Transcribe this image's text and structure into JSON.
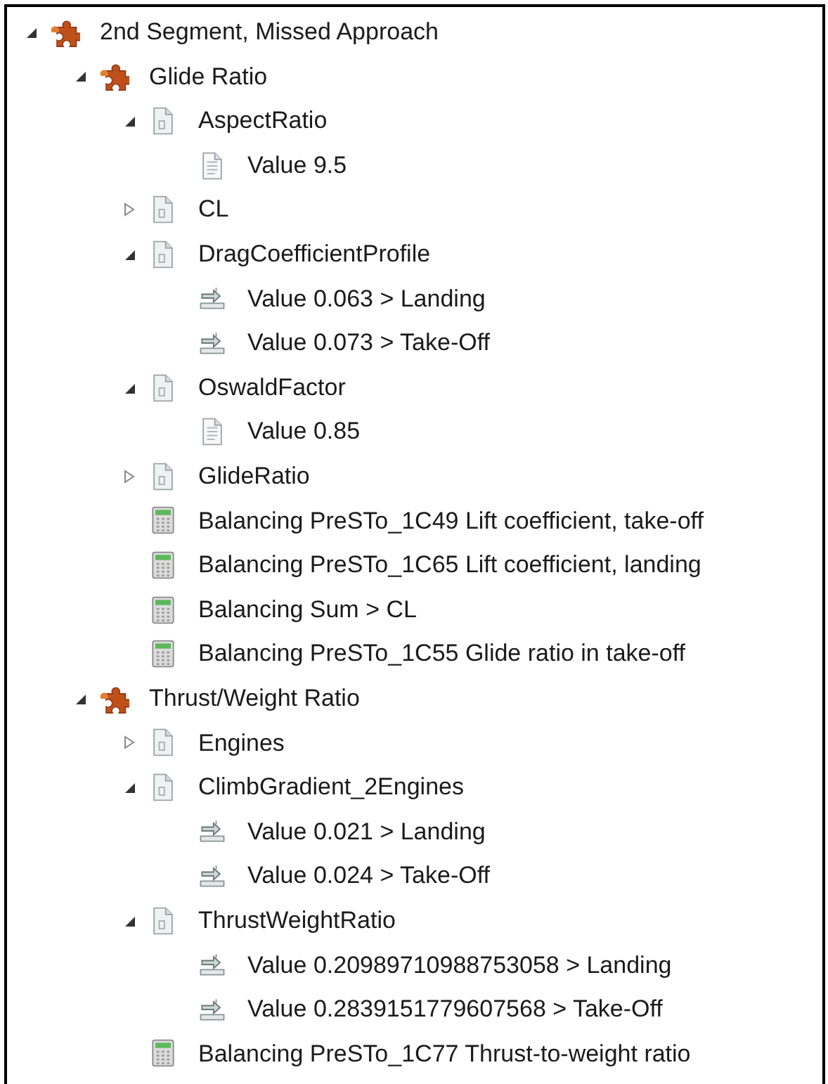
{
  "tree": [
    {
      "kind": "group",
      "label": "2nd Segment, Missed Approach",
      "expanded": true,
      "children": [
        {
          "kind": "group",
          "label": "Glide Ratio",
          "expanded": true,
          "children": [
            {
              "kind": "parameter",
              "label": "AspectRatio",
              "expanded": true,
              "children": [
                {
                  "kind": "value",
                  "label": "Value 9.5"
                }
              ]
            },
            {
              "kind": "parameter",
              "label": "CL",
              "expanded": false
            },
            {
              "kind": "parameter",
              "label": "DragCoefficientProfile",
              "expanded": true,
              "children": [
                {
                  "kind": "link",
                  "label": "Value 0.063 > Landing"
                },
                {
                  "kind": "link",
                  "label": "Value 0.073 > Take-Off"
                }
              ]
            },
            {
              "kind": "parameter",
              "label": "OswaldFactor",
              "expanded": true,
              "children": [
                {
                  "kind": "value",
                  "label": "Value 0.85"
                }
              ]
            },
            {
              "kind": "parameter",
              "label": "GlideRatio",
              "expanded": false
            },
            {
              "kind": "calculation",
              "label": "Balancing PreSTo_1C49 Lift coefficient, take-off"
            },
            {
              "kind": "calculation",
              "label": "Balancing PreSTo_1C65 Lift coefficient, landing"
            },
            {
              "kind": "calculation",
              "label": "Balancing Sum > CL"
            },
            {
              "kind": "calculation",
              "label": "Balancing PreSTo_1C55 Glide ratio in take-off"
            }
          ]
        },
        {
          "kind": "group",
          "label": "Thrust/Weight Ratio",
          "expanded": true,
          "children": [
            {
              "kind": "parameter",
              "label": "Engines",
              "expanded": false
            },
            {
              "kind": "parameter",
              "label": "ClimbGradient_2Engines",
              "expanded": true,
              "children": [
                {
                  "kind": "link",
                  "label": "Value 0.021 > Landing"
                },
                {
                  "kind": "link",
                  "label": "Value 0.024 > Take-Off"
                }
              ]
            },
            {
              "kind": "parameter",
              "label": "ThrustWeightRatio",
              "expanded": true,
              "children": [
                {
                  "kind": "link",
                  "label": "Value 0.20989710988753058 > Landing"
                },
                {
                  "kind": "link",
                  "label": "Value 0.2839151779607568 > Take-Off"
                }
              ]
            },
            {
              "kind": "calculation",
              "label": "Balancing PreSTo_1C77 Thrust-to-weight ratio"
            }
          ]
        }
      ]
    }
  ]
}
